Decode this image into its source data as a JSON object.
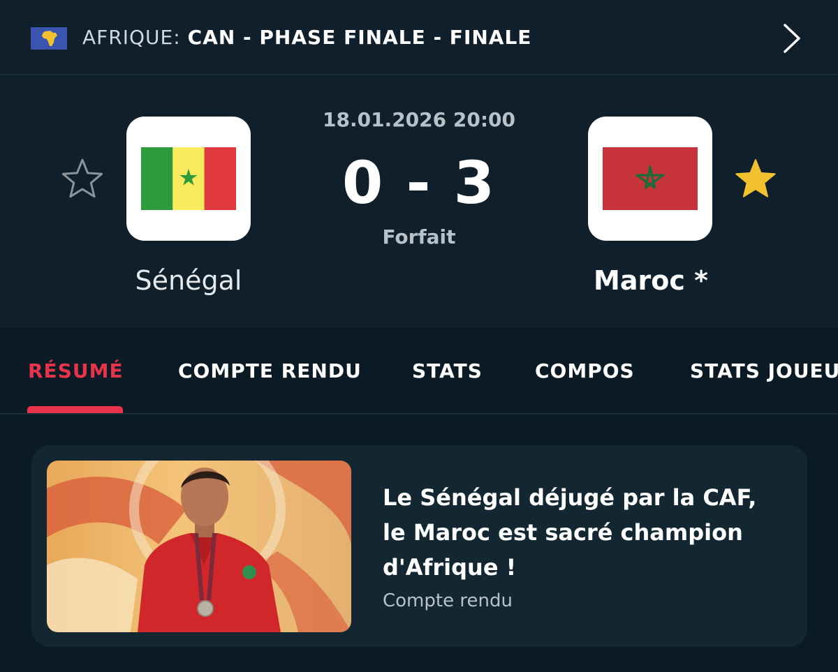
{
  "header": {
    "region": "AFRIQUE:",
    "competition": "CAN - PHASE FINALE - FINALE",
    "region_flag_icon": "africa-flag-icon",
    "chevron_icon": "chevron-right-icon"
  },
  "match": {
    "date": "18.01.2026 20:00",
    "score": "0 - 3",
    "status": "Forfait",
    "home": {
      "name": "Sénégal",
      "favorite": false,
      "flag_icon": "senegal-flag-icon"
    },
    "away": {
      "name": "Maroc *",
      "favorite": true,
      "flag_icon": "morocco-flag-icon"
    },
    "favorite_color": "#f2c12e",
    "unfavorite_color": "#8c949a"
  },
  "tabs": [
    {
      "label": "RÉSUMÉ",
      "active": true
    },
    {
      "label": "COMPTE RENDU",
      "active": false
    },
    {
      "label": "STATS",
      "active": false
    },
    {
      "label": "COMPOS",
      "active": false
    },
    {
      "label": "STATS JOUEURS",
      "active": false
    }
  ],
  "accent_color": "#e8334a",
  "article": {
    "title": "Le Sénégal déjugé par la CAF, le Maroc est sacré champion d'Afrique !",
    "subtitle": "Compte rendu",
    "image": "player-photo"
  }
}
